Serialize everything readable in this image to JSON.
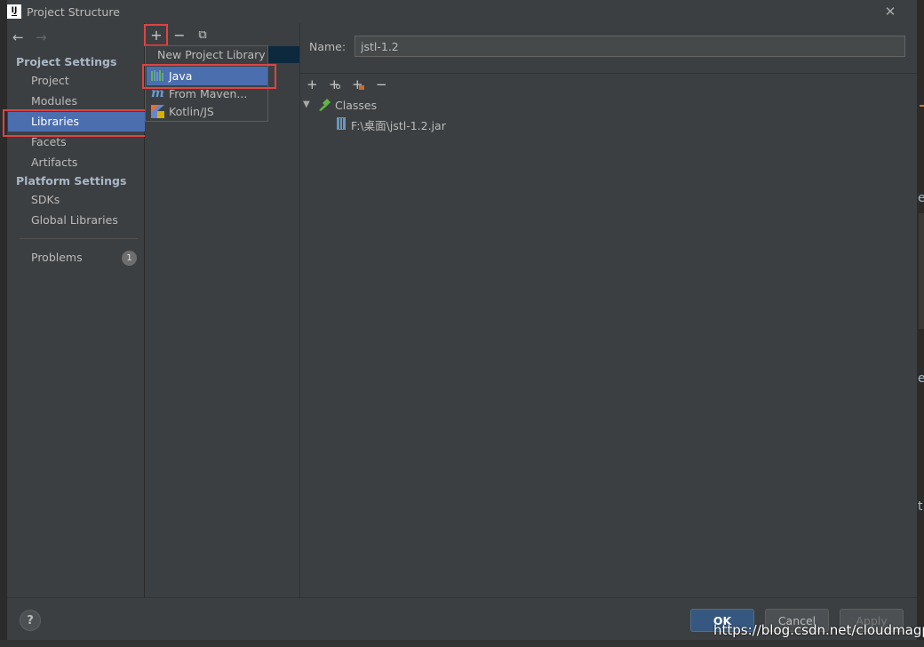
{
  "window": {
    "title": "Project Structure",
    "close_glyph": "✕",
    "logo_text": "IJ"
  },
  "nav": {
    "back_glyph": "←",
    "forward_glyph": "→",
    "project_settings_heading": "Project Settings",
    "project_settings_items": [
      "Project",
      "Modules",
      "Libraries",
      "Facets",
      "Artifacts"
    ],
    "selected_item": "Libraries",
    "platform_settings_heading": "Platform Settings",
    "platform_settings_items": [
      "SDKs",
      "Global Libraries"
    ],
    "problems_label": "Problems",
    "problems_count": "1"
  },
  "list_toolbar": {
    "add_glyph": "+",
    "remove_glyph": "−",
    "copy_glyph": "⧉"
  },
  "popup": {
    "title": "New Project Library",
    "items": [
      {
        "label": "Java",
        "icon": "java-library-icon",
        "selected": true
      },
      {
        "label": "From Maven...",
        "icon": "maven-icon",
        "selected": false
      },
      {
        "label": "Kotlin/JS",
        "icon": "kotlin-js-icon",
        "selected": false
      }
    ]
  },
  "library": {
    "name_label": "Name:",
    "name_value": "jstl-1.2",
    "toolbar": {
      "add_glyph": "+",
      "add_alt_glyph": "+",
      "add_jar_glyph": "+",
      "remove_glyph": "−"
    },
    "tree": {
      "expand_glyph": "▼",
      "root_label": "Classes",
      "children": [
        "F:\\桌面\\jstl-1.2.jar"
      ]
    }
  },
  "footer": {
    "help_glyph": "?",
    "ok_label": "OK",
    "cancel_label": "Cancel",
    "apply_label": "Apply"
  },
  "watermark": "https://blog.csdn.net/cloudmagpi_",
  "colors": {
    "selection": "#4b6eaf",
    "highlight_box": "#e04343",
    "panel": "#3c3f41",
    "ok_button": "#365880"
  }
}
